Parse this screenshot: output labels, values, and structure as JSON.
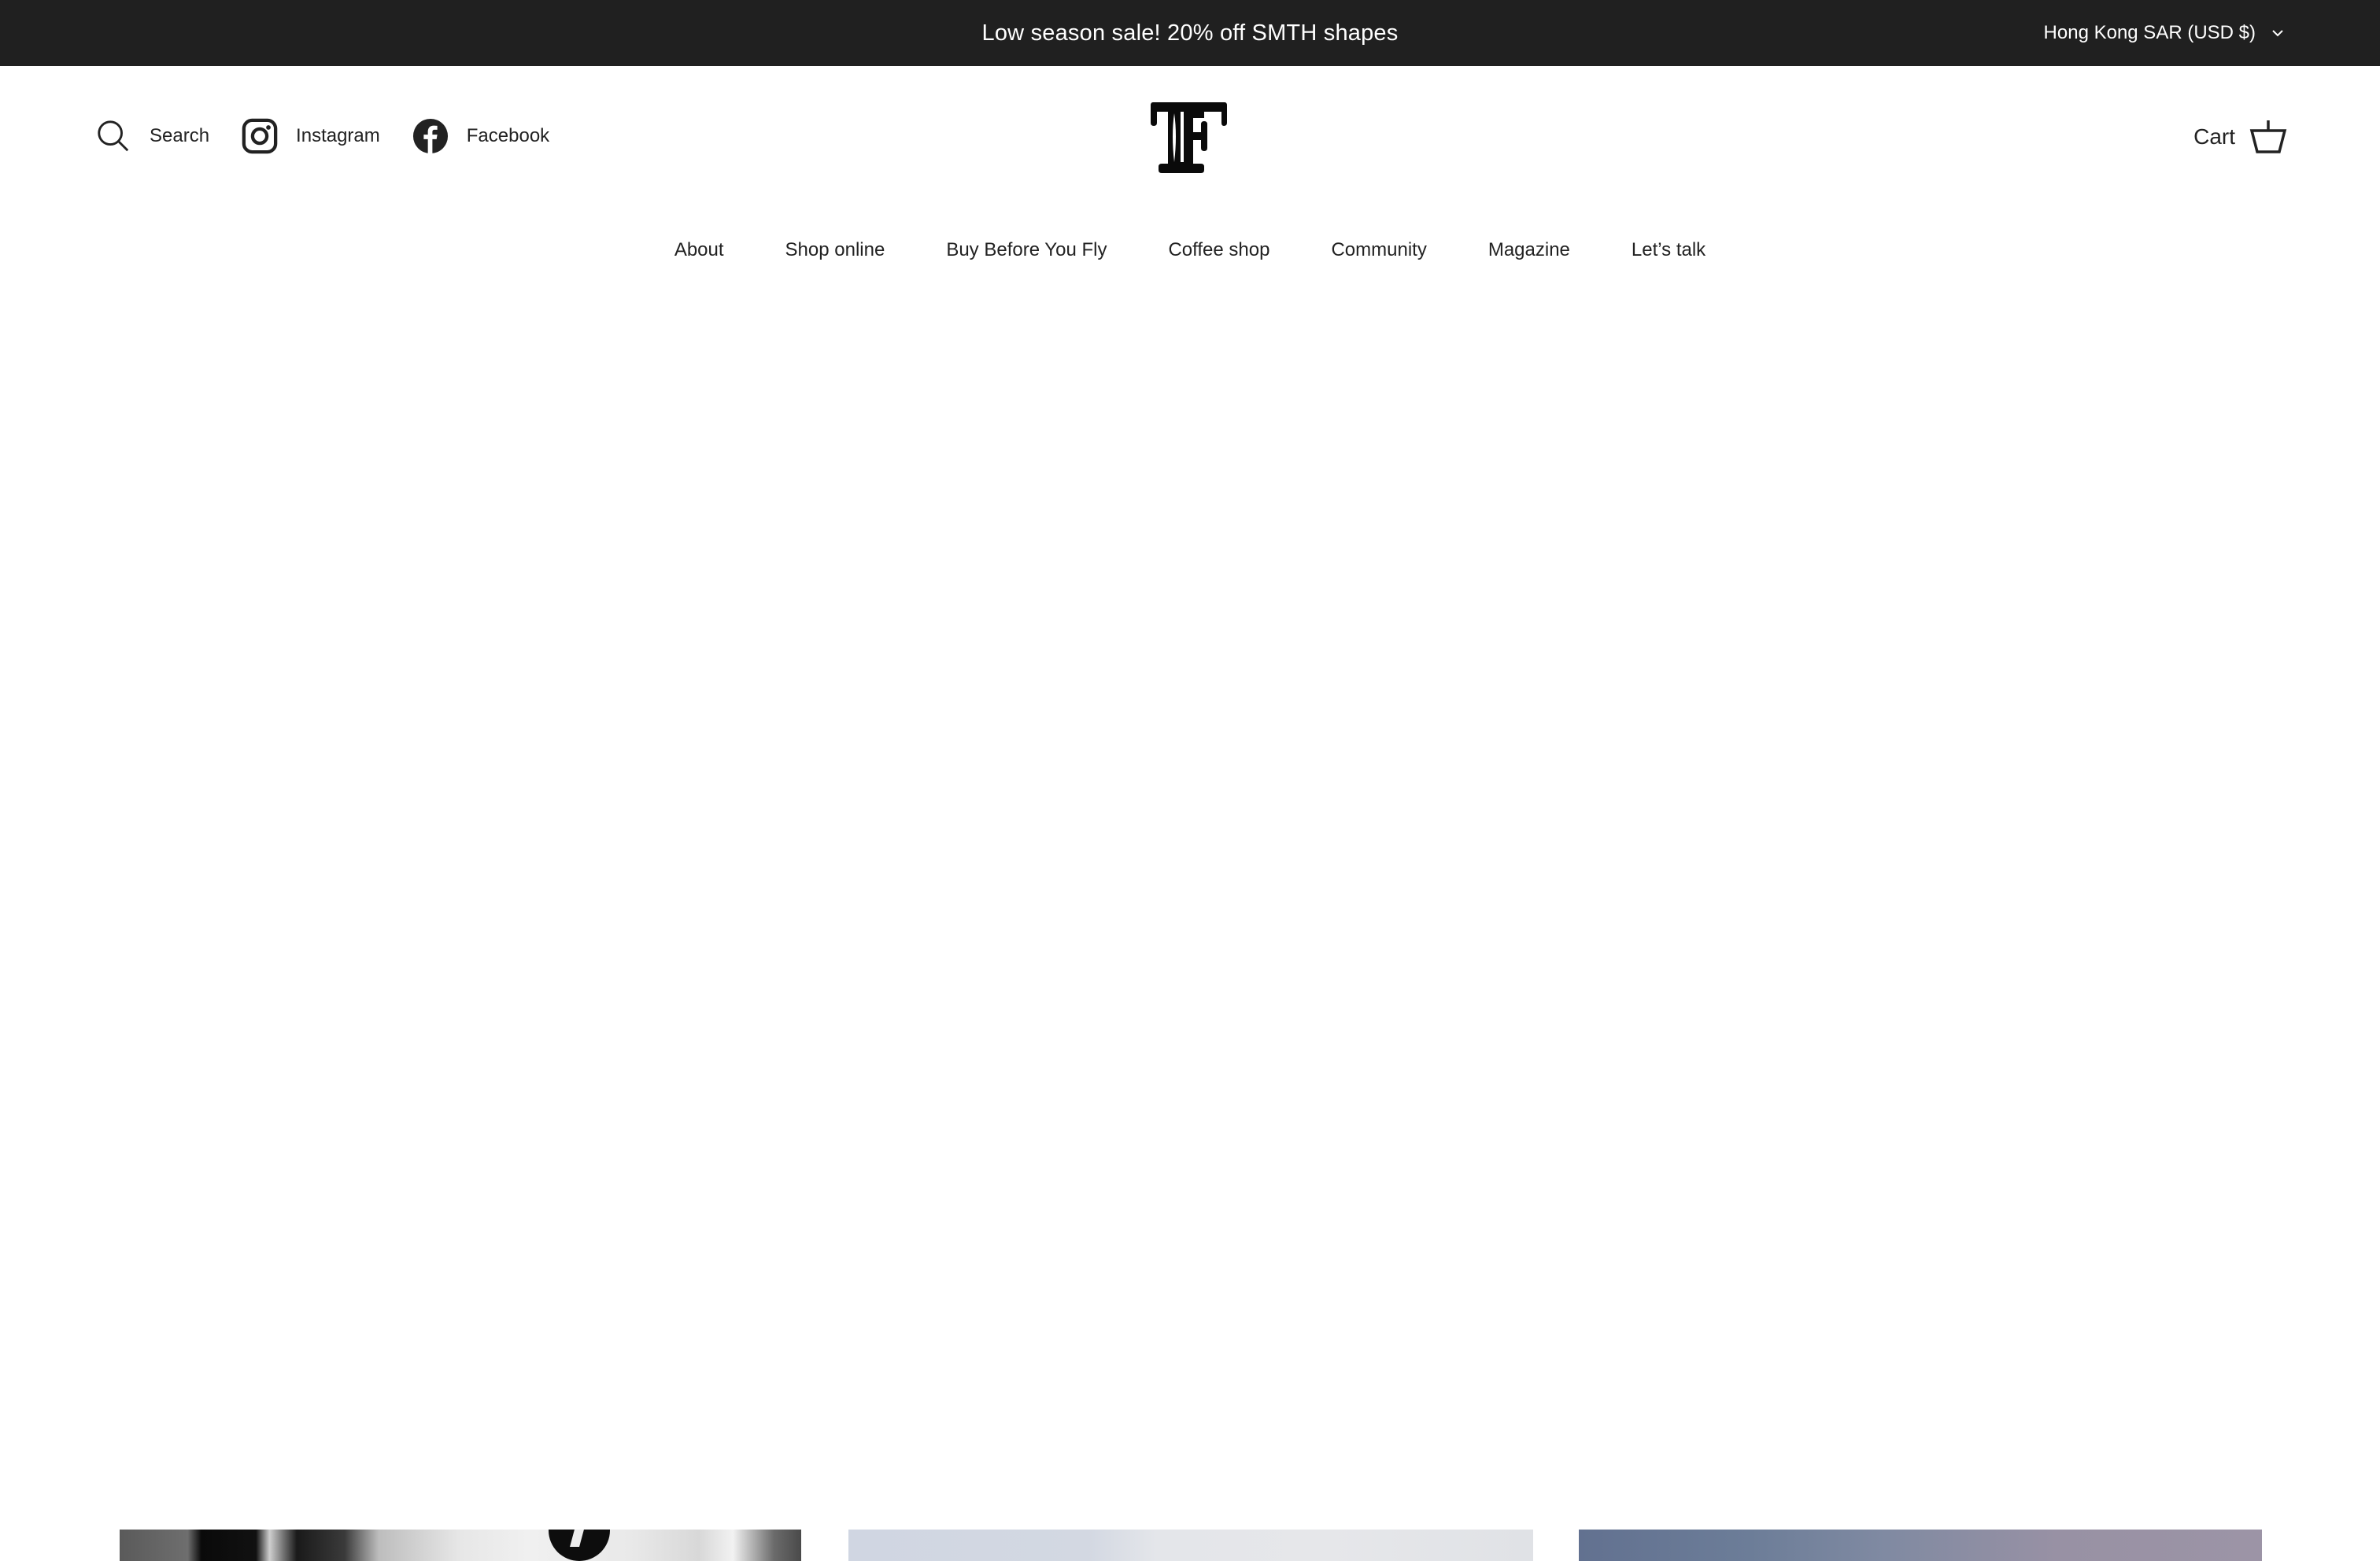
{
  "announcement": {
    "text": "Low season sale! 20% off SMTH shapes",
    "background_color": "#202020"
  },
  "region_selector": {
    "label": "Hong Kong SAR (USD $)",
    "icon": "chevron-down-icon"
  },
  "header": {
    "links": [
      {
        "label": "Search",
        "icon": "search-icon"
      },
      {
        "label": "Instagram",
        "icon": "instagram-icon"
      },
      {
        "label": "Facebook",
        "icon": "facebook-icon"
      }
    ],
    "logo": {
      "text": "TF",
      "icon": "tf-logo"
    },
    "cart": {
      "label": "Cart",
      "icon": "basket-icon"
    }
  },
  "nav": {
    "items": [
      {
        "label": "About"
      },
      {
        "label": "Shop online"
      },
      {
        "label": "Buy Before You Fly"
      },
      {
        "label": "Coffee shop"
      },
      {
        "label": "Community"
      },
      {
        "label": "Magazine"
      },
      {
        "label": "Let’s talk"
      }
    ]
  },
  "featured_cards": [
    {
      "name": "surfboard-photo"
    },
    {
      "name": "sky-photo"
    },
    {
      "name": "dusk-photo"
    }
  ]
}
